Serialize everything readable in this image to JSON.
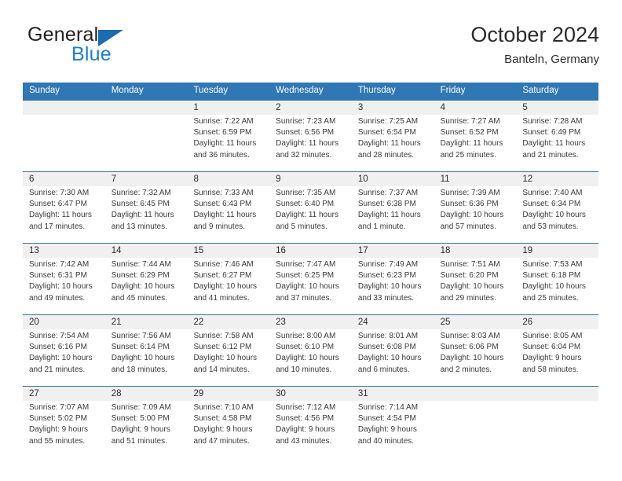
{
  "brand": {
    "line1": "General",
    "line2": "Blue",
    "triangle_color": "#1b6cb0",
    "blue_text_color": "#1b7fd4"
  },
  "header": {
    "title": "October 2024",
    "subtitle": "Banteln, Germany",
    "accent_color": "#3077b5"
  },
  "weekdays": [
    "Sunday",
    "Monday",
    "Tuesday",
    "Wednesday",
    "Thursday",
    "Friday",
    "Saturday"
  ],
  "weeks": [
    [
      {
        "day": ""
      },
      {
        "day": ""
      },
      {
        "day": "1",
        "sunrise": "Sunrise: 7:22 AM",
        "sunset": "Sunset: 6:59 PM",
        "daylight1": "Daylight: 11 hours",
        "daylight2": "and 36 minutes."
      },
      {
        "day": "2",
        "sunrise": "Sunrise: 7:23 AM",
        "sunset": "Sunset: 6:56 PM",
        "daylight1": "Daylight: 11 hours",
        "daylight2": "and 32 minutes."
      },
      {
        "day": "3",
        "sunrise": "Sunrise: 7:25 AM",
        "sunset": "Sunset: 6:54 PM",
        "daylight1": "Daylight: 11 hours",
        "daylight2": "and 28 minutes."
      },
      {
        "day": "4",
        "sunrise": "Sunrise: 7:27 AM",
        "sunset": "Sunset: 6:52 PM",
        "daylight1": "Daylight: 11 hours",
        "daylight2": "and 25 minutes."
      },
      {
        "day": "5",
        "sunrise": "Sunrise: 7:28 AM",
        "sunset": "Sunset: 6:49 PM",
        "daylight1": "Daylight: 11 hours",
        "daylight2": "and 21 minutes."
      }
    ],
    [
      {
        "day": "6",
        "sunrise": "Sunrise: 7:30 AM",
        "sunset": "Sunset: 6:47 PM",
        "daylight1": "Daylight: 11 hours",
        "daylight2": "and 17 minutes."
      },
      {
        "day": "7",
        "sunrise": "Sunrise: 7:32 AM",
        "sunset": "Sunset: 6:45 PM",
        "daylight1": "Daylight: 11 hours",
        "daylight2": "and 13 minutes."
      },
      {
        "day": "8",
        "sunrise": "Sunrise: 7:33 AM",
        "sunset": "Sunset: 6:43 PM",
        "daylight1": "Daylight: 11 hours",
        "daylight2": "and 9 minutes."
      },
      {
        "day": "9",
        "sunrise": "Sunrise: 7:35 AM",
        "sunset": "Sunset: 6:40 PM",
        "daylight1": "Daylight: 11 hours",
        "daylight2": "and 5 minutes."
      },
      {
        "day": "10",
        "sunrise": "Sunrise: 7:37 AM",
        "sunset": "Sunset: 6:38 PM",
        "daylight1": "Daylight: 11 hours",
        "daylight2": "and 1 minute."
      },
      {
        "day": "11",
        "sunrise": "Sunrise: 7:39 AM",
        "sunset": "Sunset: 6:36 PM",
        "daylight1": "Daylight: 10 hours",
        "daylight2": "and 57 minutes."
      },
      {
        "day": "12",
        "sunrise": "Sunrise: 7:40 AM",
        "sunset": "Sunset: 6:34 PM",
        "daylight1": "Daylight: 10 hours",
        "daylight2": "and 53 minutes."
      }
    ],
    [
      {
        "day": "13",
        "sunrise": "Sunrise: 7:42 AM",
        "sunset": "Sunset: 6:31 PM",
        "daylight1": "Daylight: 10 hours",
        "daylight2": "and 49 minutes."
      },
      {
        "day": "14",
        "sunrise": "Sunrise: 7:44 AM",
        "sunset": "Sunset: 6:29 PM",
        "daylight1": "Daylight: 10 hours",
        "daylight2": "and 45 minutes."
      },
      {
        "day": "15",
        "sunrise": "Sunrise: 7:46 AM",
        "sunset": "Sunset: 6:27 PM",
        "daylight1": "Daylight: 10 hours",
        "daylight2": "and 41 minutes."
      },
      {
        "day": "16",
        "sunrise": "Sunrise: 7:47 AM",
        "sunset": "Sunset: 6:25 PM",
        "daylight1": "Daylight: 10 hours",
        "daylight2": "and 37 minutes."
      },
      {
        "day": "17",
        "sunrise": "Sunrise: 7:49 AM",
        "sunset": "Sunset: 6:23 PM",
        "daylight1": "Daylight: 10 hours",
        "daylight2": "and 33 minutes."
      },
      {
        "day": "18",
        "sunrise": "Sunrise: 7:51 AM",
        "sunset": "Sunset: 6:20 PM",
        "daylight1": "Daylight: 10 hours",
        "daylight2": "and 29 minutes."
      },
      {
        "day": "19",
        "sunrise": "Sunrise: 7:53 AM",
        "sunset": "Sunset: 6:18 PM",
        "daylight1": "Daylight: 10 hours",
        "daylight2": "and 25 minutes."
      }
    ],
    [
      {
        "day": "20",
        "sunrise": "Sunrise: 7:54 AM",
        "sunset": "Sunset: 6:16 PM",
        "daylight1": "Daylight: 10 hours",
        "daylight2": "and 21 minutes."
      },
      {
        "day": "21",
        "sunrise": "Sunrise: 7:56 AM",
        "sunset": "Sunset: 6:14 PM",
        "daylight1": "Daylight: 10 hours",
        "daylight2": "and 18 minutes."
      },
      {
        "day": "22",
        "sunrise": "Sunrise: 7:58 AM",
        "sunset": "Sunset: 6:12 PM",
        "daylight1": "Daylight: 10 hours",
        "daylight2": "and 14 minutes."
      },
      {
        "day": "23",
        "sunrise": "Sunrise: 8:00 AM",
        "sunset": "Sunset: 6:10 PM",
        "daylight1": "Daylight: 10 hours",
        "daylight2": "and 10 minutes."
      },
      {
        "day": "24",
        "sunrise": "Sunrise: 8:01 AM",
        "sunset": "Sunset: 6:08 PM",
        "daylight1": "Daylight: 10 hours",
        "daylight2": "and 6 minutes."
      },
      {
        "day": "25",
        "sunrise": "Sunrise: 8:03 AM",
        "sunset": "Sunset: 6:06 PM",
        "daylight1": "Daylight: 10 hours",
        "daylight2": "and 2 minutes."
      },
      {
        "day": "26",
        "sunrise": "Sunrise: 8:05 AM",
        "sunset": "Sunset: 6:04 PM",
        "daylight1": "Daylight: 9 hours",
        "daylight2": "and 58 minutes."
      }
    ],
    [
      {
        "day": "27",
        "sunrise": "Sunrise: 7:07 AM",
        "sunset": "Sunset: 5:02 PM",
        "daylight1": "Daylight: 9 hours",
        "daylight2": "and 55 minutes."
      },
      {
        "day": "28",
        "sunrise": "Sunrise: 7:09 AM",
        "sunset": "Sunset: 5:00 PM",
        "daylight1": "Daylight: 9 hours",
        "daylight2": "and 51 minutes."
      },
      {
        "day": "29",
        "sunrise": "Sunrise: 7:10 AM",
        "sunset": "Sunset: 4:58 PM",
        "daylight1": "Daylight: 9 hours",
        "daylight2": "and 47 minutes."
      },
      {
        "day": "30",
        "sunrise": "Sunrise: 7:12 AM",
        "sunset": "Sunset: 4:56 PM",
        "daylight1": "Daylight: 9 hours",
        "daylight2": "and 43 minutes."
      },
      {
        "day": "31",
        "sunrise": "Sunrise: 7:14 AM",
        "sunset": "Sunset: 4:54 PM",
        "daylight1": "Daylight: 9 hours",
        "daylight2": "and 40 minutes."
      },
      {
        "day": ""
      },
      {
        "day": ""
      }
    ]
  ]
}
